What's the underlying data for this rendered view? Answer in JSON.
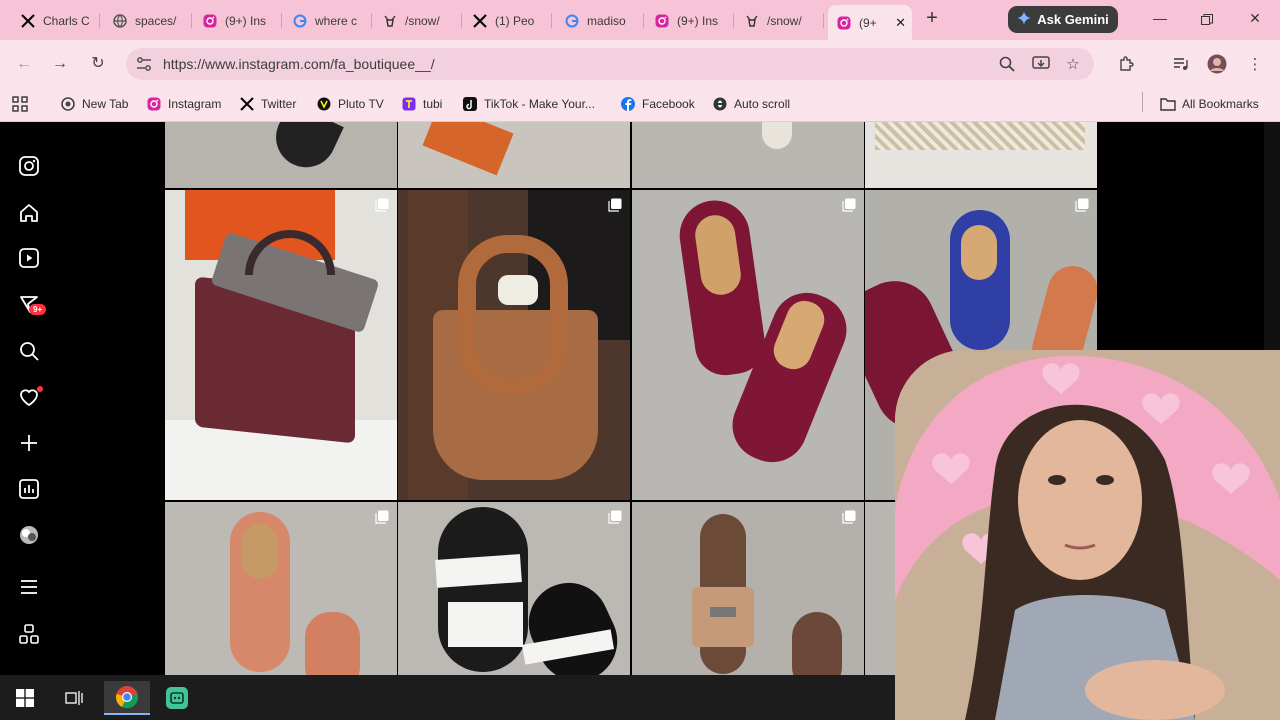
{
  "browser": {
    "tabs": [
      {
        "label": "Charls C",
        "icon": "x-icon"
      },
      {
        "label": "spaces/",
        "icon": "globe-icon"
      },
      {
        "label": "(9+) Ins",
        "icon": "instagram-icon"
      },
      {
        "label": "where c",
        "icon": "google-icon"
      },
      {
        "label": "/snow/",
        "icon": "dog-icon"
      },
      {
        "label": "(1) Peo",
        "icon": "x-icon"
      },
      {
        "label": "madiso",
        "icon": "google-icon"
      },
      {
        "label": "(9+) Ins",
        "icon": "instagram-icon"
      },
      {
        "label": "/snow/",
        "icon": "dog-icon"
      },
      {
        "label": "(9+",
        "icon": "instagram-icon",
        "active": true
      }
    ],
    "new_tab": "+",
    "gemini_label": "Ask Gemini",
    "url": "https://www.instagram.com/fa_boutiquee__/",
    "bookmarks": [
      {
        "label": "New Tab",
        "icon": "chrome-icon"
      },
      {
        "label": "Instagram",
        "icon": "instagram-icon"
      },
      {
        "label": "Twitter",
        "icon": "x-icon"
      },
      {
        "label": "Pluto TV",
        "icon": "pluto-icon"
      },
      {
        "label": "tubi",
        "icon": "tubi-icon"
      },
      {
        "label": "TikTok - Make Your...",
        "icon": "tiktok-icon"
      },
      {
        "label": "Facebook",
        "icon": "facebook-icon"
      },
      {
        "label": "Auto scroll",
        "icon": "autoscroll-icon"
      }
    ],
    "all_bookmarks": "All Bookmarks"
  },
  "instagram": {
    "notification_badge": "9+",
    "sidebar": [
      "instagram-logo-icon",
      "home-icon",
      "reels-icon",
      "messages-icon",
      "search-icon",
      "heart-icon",
      "create-icon",
      "dashboard-icon",
      "profile-avatar",
      "menu-icon",
      "more-icon"
    ],
    "posts": [
      {
        "row": 0,
        "subject": "shoe"
      },
      {
        "row": 0,
        "subject": "shoe box"
      },
      {
        "row": 0,
        "subject": "shoe"
      },
      {
        "row": 0,
        "subject": "patterned item"
      },
      {
        "row": 1,
        "subject": "burgundy handbag"
      },
      {
        "row": 1,
        "subject": "tan tote bag"
      },
      {
        "row": 1,
        "subject": "burgundy loafers"
      },
      {
        "row": 1,
        "subject": "blue loafer"
      },
      {
        "row": 2,
        "subject": "salmon loafer"
      },
      {
        "row": 2,
        "subject": "black white sandal"
      },
      {
        "row": 2,
        "subject": "tan sandal"
      }
    ]
  },
  "colors": {
    "tab_strip": "#f6c4d6",
    "toolbar": "#fbe3ec",
    "omnibox": "#f3d0de",
    "gemini": "#3c3c3c",
    "taskbar": "#1c1c1c"
  }
}
